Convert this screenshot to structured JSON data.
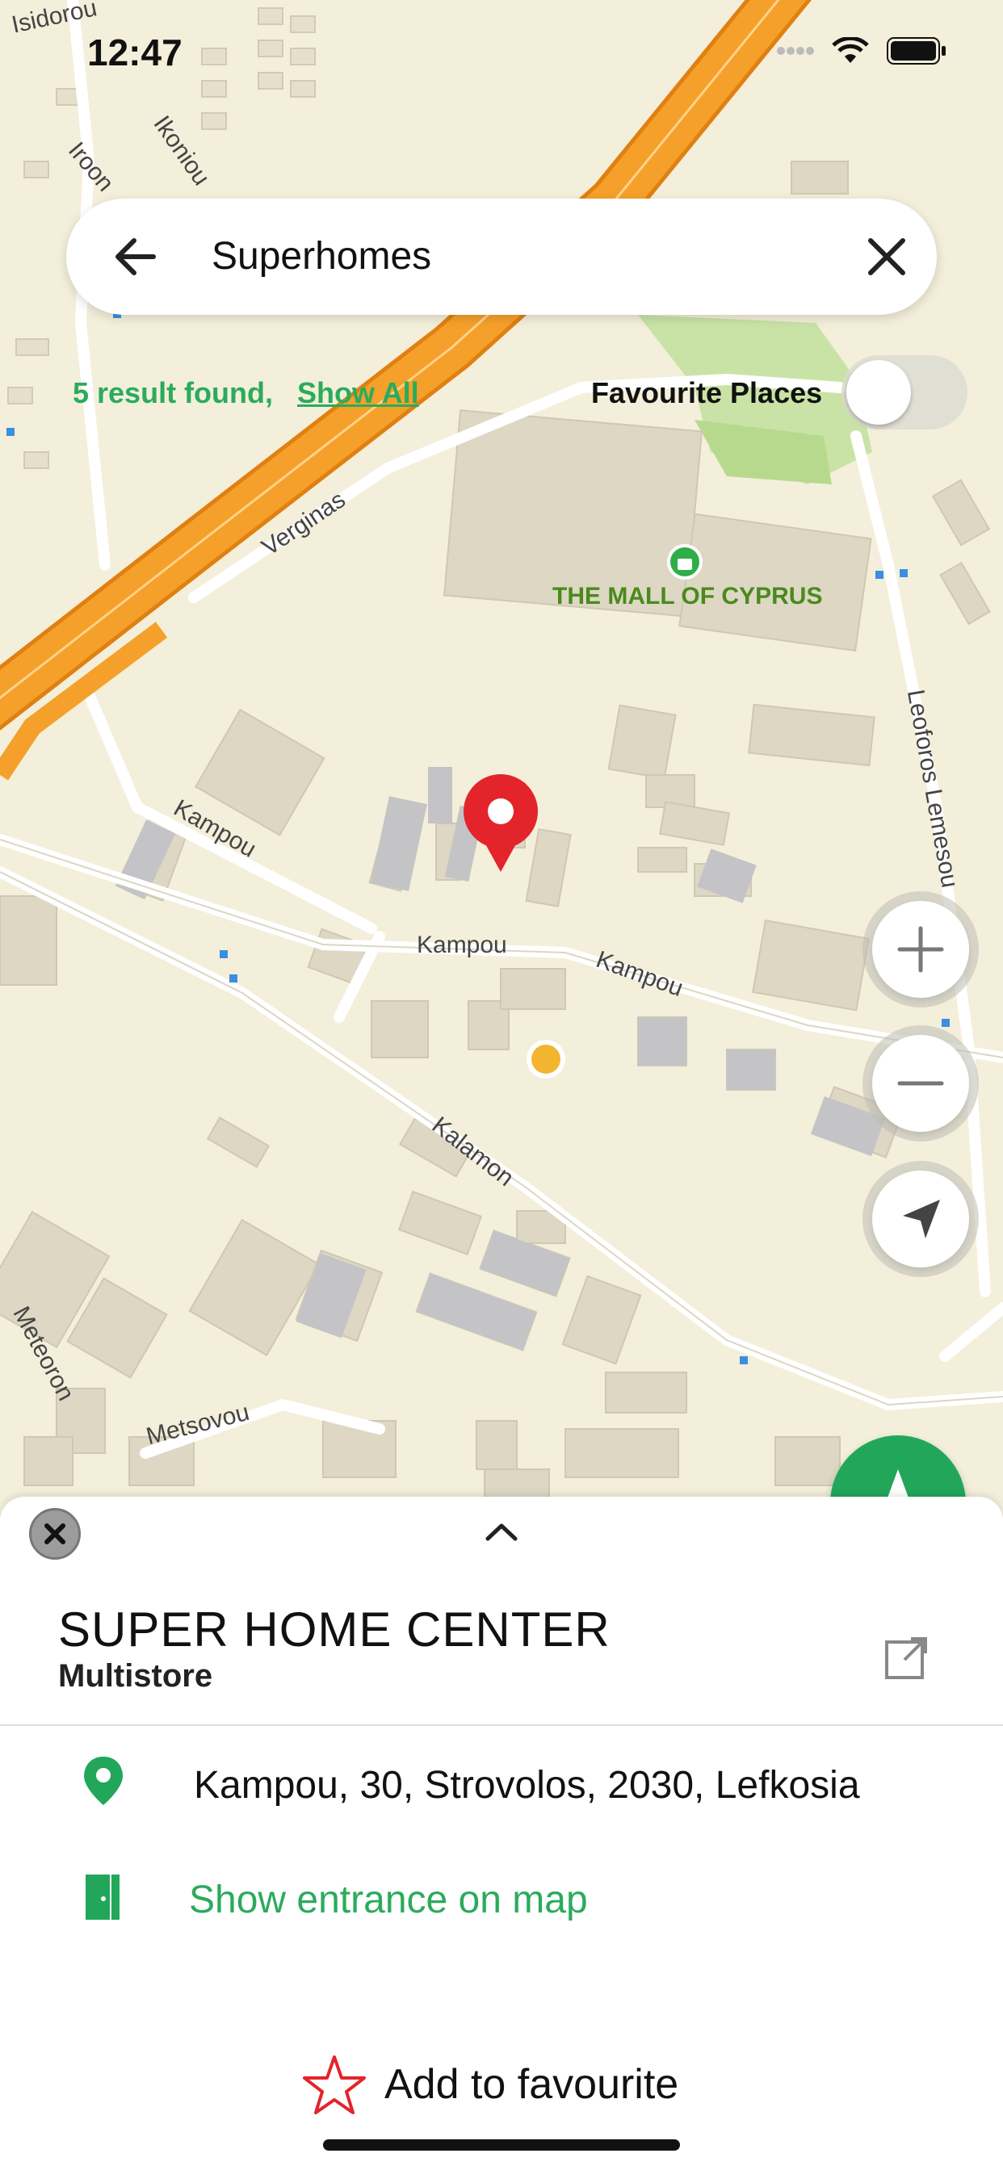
{
  "status_bar": {
    "time": "12:47"
  },
  "search": {
    "query": "Superhomes"
  },
  "results": {
    "count_text": "5 result found,",
    "show_all": "Show All"
  },
  "favourite_places": {
    "label": "Favourite Places",
    "enabled": false
  },
  "map_labels": {
    "isidorou": "Isidorou",
    "ikoniou": "Ikoniou",
    "iroon": "Iroon",
    "verginas": "Verginas",
    "mall": "THE MALL OF CYPRUS",
    "leoforos": "Leoforos Lemesou",
    "kampou1": "Kampou",
    "kampou2": "Kampou",
    "kampou3": "Kampou",
    "kalamon": "Kalamon",
    "meteoron": "Meteoron",
    "metsovou": "Metsovou"
  },
  "place": {
    "title": "SUPER HOME CENTER",
    "category": "Multistore",
    "address": "Kampou, 30, Strovolos, 2030, Lefkosia",
    "entrance": "Show entrance on map",
    "favourite": "Add to favourite"
  },
  "colors": {
    "accent": "#22a75a",
    "pin": "#e3242b",
    "highway": "#f0951c"
  }
}
